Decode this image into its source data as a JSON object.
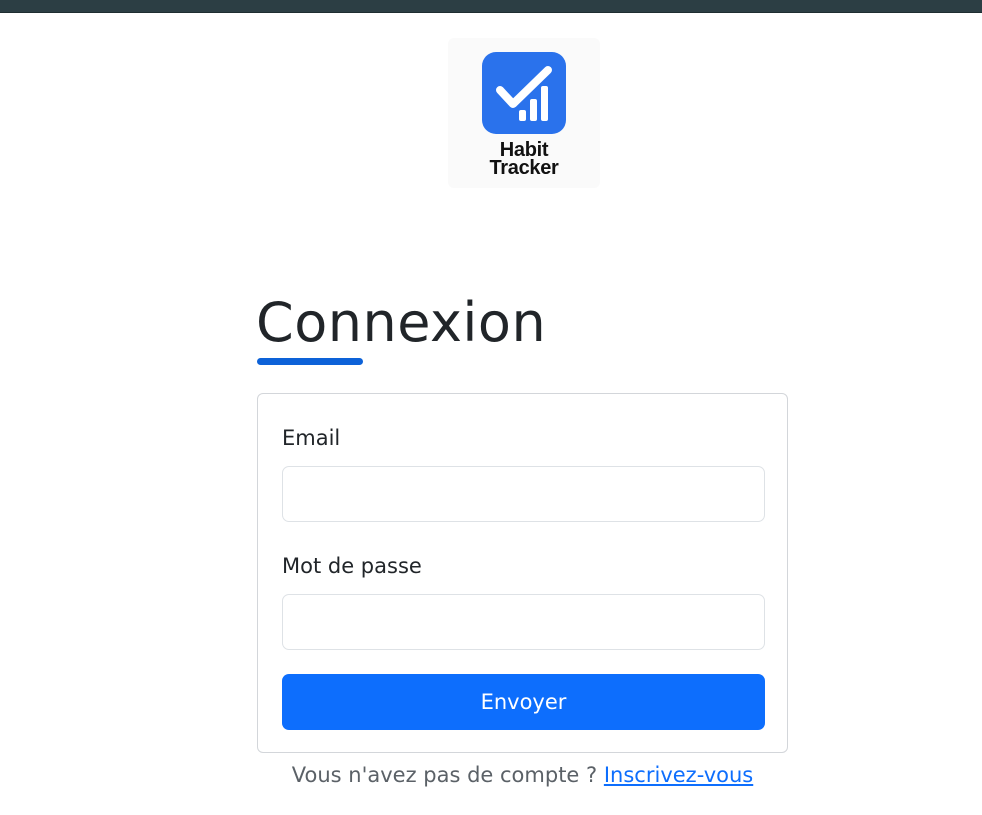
{
  "app": {
    "logo_line1": "Habit",
    "logo_line2": "Tracker",
    "logo_icon": "checkmark-bars-icon",
    "logo_bg_color": "#2a72ec"
  },
  "header": {
    "bar_color": "#2c3e44"
  },
  "login": {
    "title": "Connexion",
    "accent_color": "#0d62d8",
    "email_label": "Email",
    "email_value": "",
    "email_placeholder": "",
    "password_label": "Mot de passe",
    "password_value": "",
    "password_placeholder": "",
    "submit_label": "Envoyer",
    "submit_color": "#0d6efd",
    "signup_prompt": "Vous n'avez pas de compte ?",
    "signup_link": "Inscrivez-vous"
  }
}
